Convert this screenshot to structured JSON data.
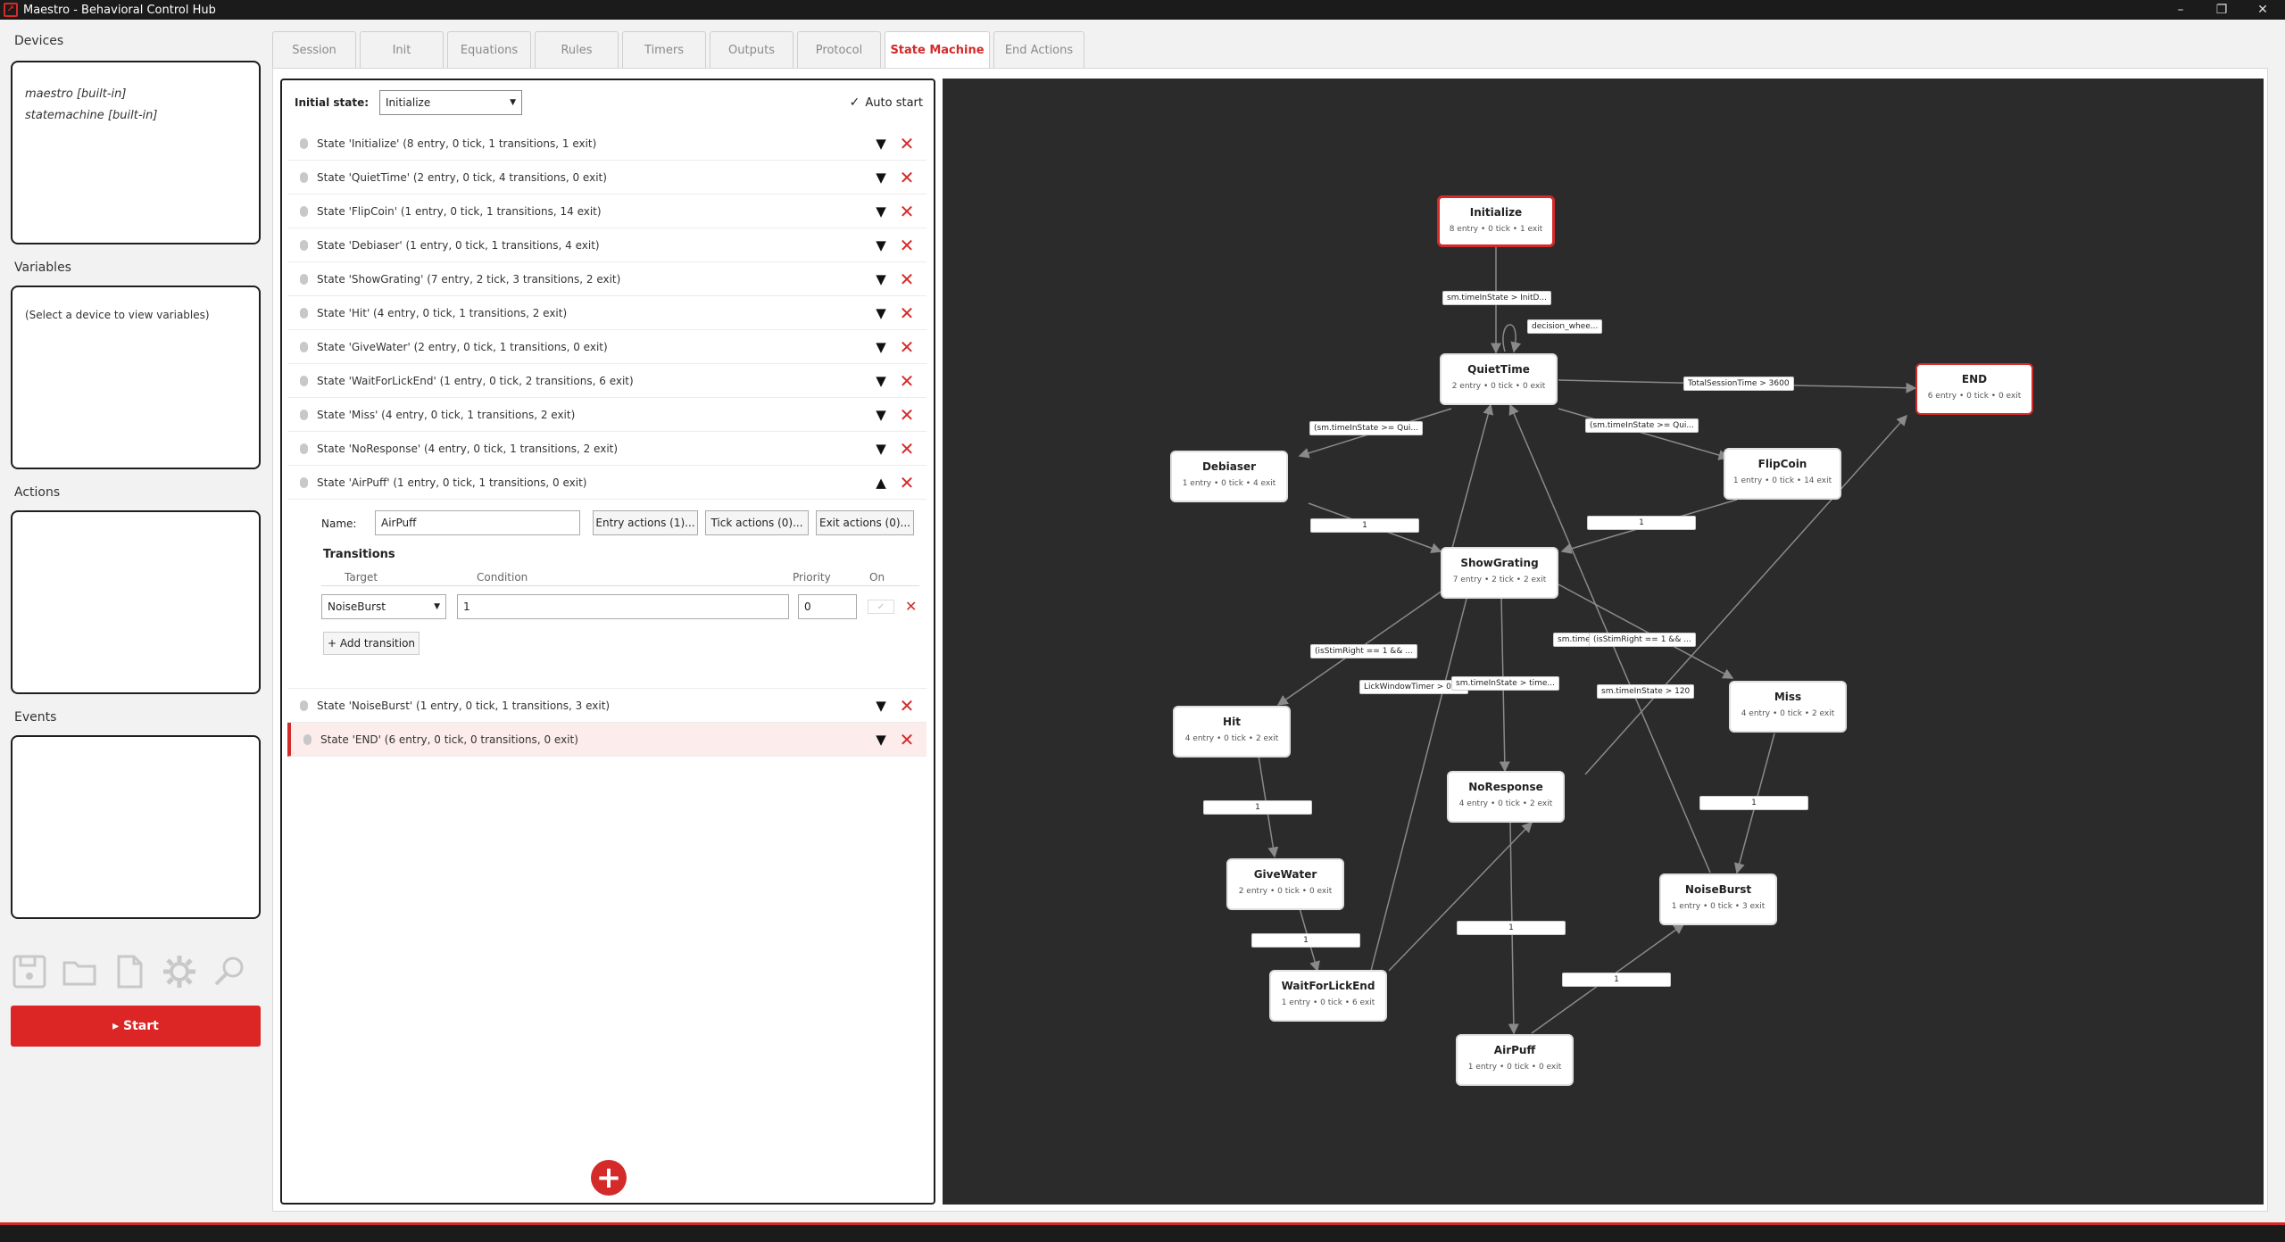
{
  "app": {
    "title": "Maestro - Behavioral Control Hub"
  },
  "sidebar": {
    "devices_label": "Devices",
    "devices": [
      "maestro  [built-in]",
      "statemachine  [built-in]"
    ],
    "variables_label": "Variables",
    "variables_placeholder": "(Select a device to view variables)",
    "actions_label": "Actions",
    "events_label": "Events",
    "icons": [
      "save-icon",
      "folder-open-icon",
      "new-file-icon",
      "settings-gear-icon",
      "search-icon"
    ],
    "start_label": "▸  Start",
    "accent_color": "#dc2525"
  },
  "tabs": [
    "Session",
    "Init",
    "Equations",
    "Rules",
    "Timers",
    "Outputs",
    "Protocol",
    "State Machine",
    "End Actions"
  ],
  "active_tab": "State Machine",
  "state_list": {
    "initial_state_label": "Initial state:",
    "initial_state_value": "Initialize",
    "auto_start_label": "Auto start",
    "auto_start_checked": true,
    "states": [
      "State 'Initialize'   (8 entry, 0 tick, 1 transitions, 1 exit)",
      "State 'QuietTime'   (2 entry, 0 tick, 4 transitions, 0 exit)",
      "State 'FlipCoin'   (1 entry, 0 tick, 1 transitions, 14 exit)",
      "State 'Debiaser'   (1 entry, 0 tick, 1 transitions, 4 exit)",
      "State 'ShowGrating'   (7 entry, 2 tick, 3 transitions, 2 exit)",
      "State 'Hit'   (4 entry, 0 tick, 1 transitions, 2 exit)",
      "State 'GiveWater'   (2 entry, 0 tick, 1 transitions, 0 exit)",
      "State 'WaitForLickEnd'   (1 entry, 0 tick, 2 transitions, 6 exit)",
      "State 'Miss'   (4 entry, 0 tick, 1 transitions, 2 exit)",
      "State 'NoResponse'   (4 entry, 0 tick, 1 transitions, 2 exit)",
      "State 'AirPuff'   (1 entry, 0 tick, 1 transitions, 0 exit)"
    ],
    "states_after": [
      "State 'NoiseBurst'   (1 entry, 0 tick, 1 transitions, 3 exit)",
      "State 'END'   (6 entry, 0 tick, 0 transitions, 0 exit)"
    ],
    "editor": {
      "name_label": "Name:",
      "name_value": "AirPuff",
      "entry_actions": "Entry actions (1)...",
      "tick_actions": "Tick actions (0)...",
      "exit_actions": "Exit actions (0)...",
      "transitions_title": "Transitions",
      "col_target": "Target",
      "col_condition": "Condition",
      "col_priority": "Priority",
      "col_on": "On",
      "target_value": "NoiseBurst",
      "condition_value": "1",
      "priority_value": "0",
      "add_transition": "+ Add transition"
    },
    "add_state": "+"
  },
  "graph": {
    "nodes": [
      {
        "name": "Initialize",
        "stats": "8 entry • 0 tick • 1 exit"
      },
      {
        "name": "QuietTime",
        "stats": "2 entry • 0 tick • 0 exit"
      },
      {
        "name": "END",
        "stats": "6 entry • 0 tick • 0 exit"
      },
      {
        "name": "Debiaser",
        "stats": "1 entry • 0 tick • 4 exit"
      },
      {
        "name": "FlipCoin",
        "stats": "1 entry • 0 tick • 14 exit"
      },
      {
        "name": "ShowGrating",
        "stats": "7 entry • 2 tick • 2 exit"
      },
      {
        "name": "Hit",
        "stats": "4 entry • 0 tick • 2 exit"
      },
      {
        "name": "Miss",
        "stats": "4 entry • 0 tick • 2 exit"
      },
      {
        "name": "NoResponse",
        "stats": "4 entry • 0 tick • 2 exit"
      },
      {
        "name": "GiveWater",
        "stats": "2 entry • 0 tick • 0 exit"
      },
      {
        "name": "NoiseBurst",
        "stats": "1 entry • 0 tick • 3 exit"
      },
      {
        "name": "WaitForLickEnd",
        "stats": "1 entry • 0 tick • 6 exit"
      },
      {
        "name": "AirPuff",
        "stats": "1 entry • 0 tick • 0 exit"
      }
    ],
    "edge_labels": [
      "sm.timeInState > InitD...",
      "decision_whee...",
      "TotalSessionTime > 3600",
      "(sm.timeInState >= Qui...",
      "(sm.timeInState >= Qui...",
      "1",
      "1",
      "(isStimRight == 1 && ...",
      "sm.time",
      "(isStimRight == 1 && ...",
      "LickWindowTimer > 0.75",
      "sm.timeInState > time...",
      "sm.timeInState > 120",
      "1",
      "1",
      "1",
      "1",
      "1"
    ]
  }
}
